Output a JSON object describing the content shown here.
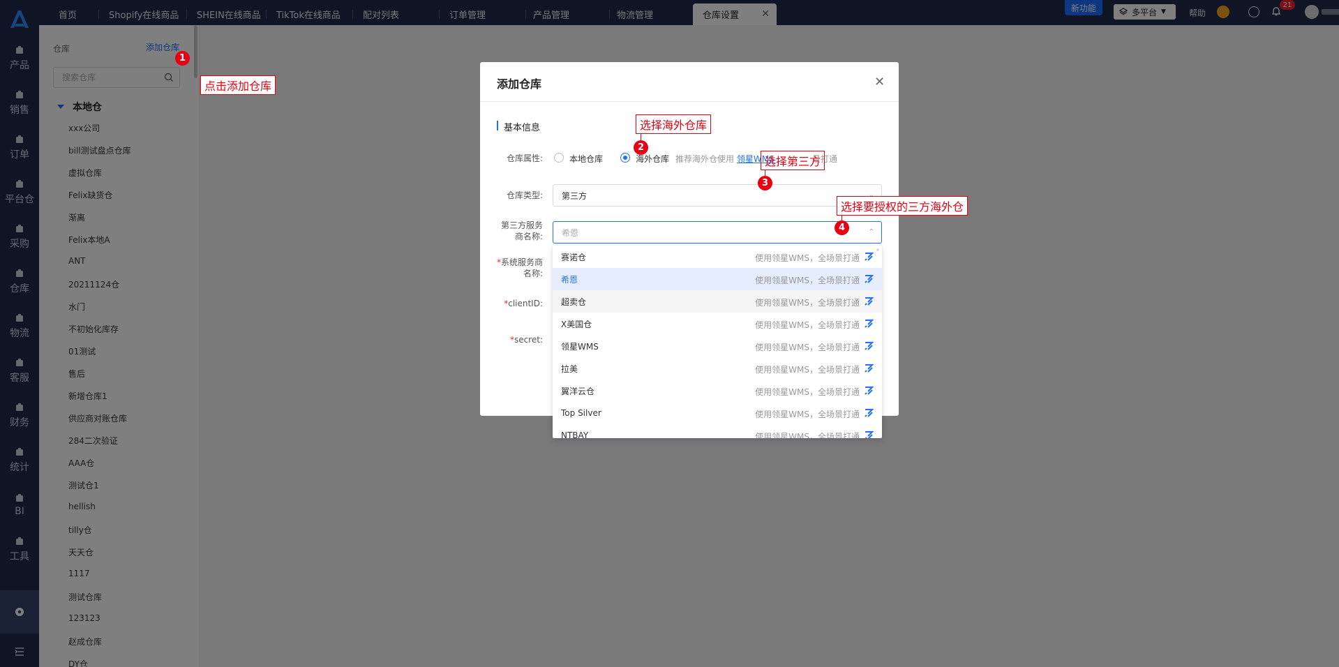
{
  "nav": {
    "items": [
      {
        "label": "产品",
        "icon": "product-icon"
      },
      {
        "label": "销售",
        "icon": "sales-icon"
      },
      {
        "label": "订单",
        "icon": "order-icon"
      },
      {
        "label": "平台仓",
        "icon": "platform-warehouse-icon"
      },
      {
        "label": "采购",
        "icon": "cart-icon"
      },
      {
        "label": "仓库",
        "icon": "warehouse-icon"
      },
      {
        "label": "物流",
        "icon": "truck-icon"
      },
      {
        "label": "客服",
        "icon": "mail-icon"
      },
      {
        "label": "财务",
        "icon": "finance-icon"
      },
      {
        "label": "统计",
        "icon": "pie-chart-icon"
      },
      {
        "label": "BI",
        "icon": "bi-icon"
      },
      {
        "label": "工具",
        "icon": "tool-icon"
      }
    ]
  },
  "topbar": {
    "tabs": [
      "首页",
      "Shopify在线商品",
      "SHEIN在线商品",
      "TikTok在线商品",
      "配对列表",
      "订单管理",
      "产品管理",
      "物流管理",
      "仓库设置"
    ],
    "active_tab": "仓库设置",
    "new_feature": "新功能",
    "platform": "多平台",
    "help": "帮助",
    "notification_count": "21"
  },
  "warehouse_panel": {
    "title": "仓库",
    "add_label": "添加仓库",
    "search_placeholder": "搜索仓库",
    "group": "本地仓",
    "items": [
      "xxx公司",
      "bill测试盘点仓库",
      "虚拟仓库",
      "Felix缺货仓",
      "渐离",
      "Felix本地A",
      "ANT",
      "20211124仓",
      "水门",
      "不初始化库存",
      "01测试",
      "售后",
      "新增仓库1",
      "供应商对账仓库",
      "284二次验证",
      "AAA仓",
      "测试仓1",
      "hellish",
      "tilly仓",
      "天天仓",
      "1117",
      "测试仓库",
      "123123",
      "赵成仓库",
      "DY仓"
    ]
  },
  "modal": {
    "title": "添加仓库",
    "section": "基本信息",
    "attr_label": "仓库属性:",
    "radio_local": "本地仓库",
    "radio_overseas": "海外仓库",
    "hint_prefix": "推荐海外仓使用",
    "hint_link": "领星WMS",
    "hint_suffix": "景打通",
    "type_label": "仓库类型:",
    "type_value": "第三方",
    "provider_label_1": "第三方服务",
    "provider_label_2": "商名称:",
    "provider_value": "希恩",
    "sys_label_1": "系统服务商",
    "sys_label_2": "名称:",
    "client_label": "clientID:",
    "secret_label": "secret:"
  },
  "dropdown": {
    "hint": "使用领星WMS，全场景打通",
    "options": [
      "赛诺仓",
      "希恩",
      "超卖仓",
      "X美国仓",
      "领星WMS",
      "拉美",
      "翼洋云仓",
      "Top Silver",
      "NTBAY"
    ],
    "selected": "希恩",
    "hovered": "超卖仓"
  },
  "annotations": {
    "steps": [
      "1",
      "2",
      "3",
      "4"
    ],
    "notes": [
      "点击添加仓库",
      "选择海外仓库",
      "选择第三方",
      "选择要授权的三方海外仓"
    ]
  },
  "colors": {
    "nav_bg": "#1e2a4a",
    "accent": "#1f6fff",
    "annotation": "#e60012"
  }
}
